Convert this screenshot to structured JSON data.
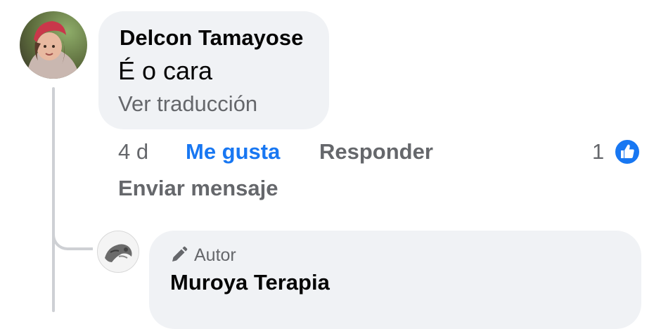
{
  "comment": {
    "author": "Delcon Tamayose",
    "text": "É o cara",
    "translate_link": "Ver traducción",
    "time": "4 d",
    "like_label": "Me gusta",
    "reply_label": "Responder",
    "send_message_label": "Enviar mensaje",
    "reaction_count": "1",
    "reaction_icon": "thumbs-up-icon",
    "avatar_icon": "user-avatar"
  },
  "reply": {
    "badge_icon": "pencil-icon",
    "badge_label": "Autor",
    "author": "Muroya Terapia",
    "avatar_icon": "page-avatar"
  },
  "colors": {
    "like_blue": "#1877f2",
    "bubble_bg": "#f0f2f5",
    "secondary_text": "#65676b",
    "primary_text": "#050505",
    "thread_line": "#ced0d4"
  }
}
